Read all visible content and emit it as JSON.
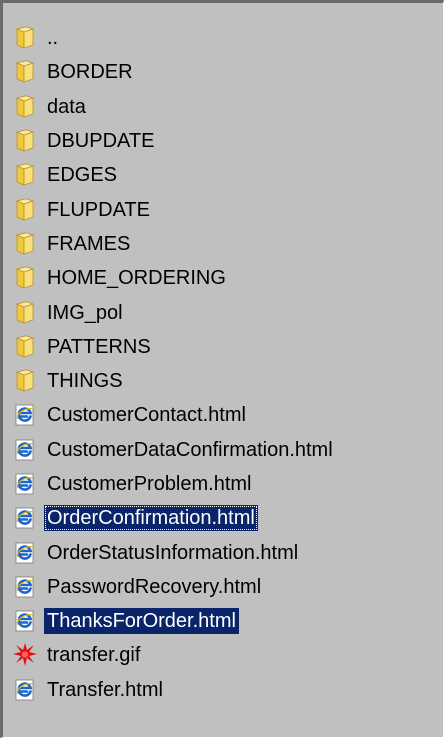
{
  "file_list": {
    "items": [
      {
        "name": "..",
        "type": "folder",
        "icon": "folder-icon",
        "selected": false
      },
      {
        "name": "BORDER",
        "type": "folder",
        "icon": "folder-icon",
        "selected": false
      },
      {
        "name": "data",
        "type": "folder",
        "icon": "folder-icon",
        "selected": false
      },
      {
        "name": "DBUPDATE",
        "type": "folder",
        "icon": "folder-icon",
        "selected": false
      },
      {
        "name": "EDGES",
        "type": "folder",
        "icon": "folder-icon",
        "selected": false
      },
      {
        "name": "FLUPDATE",
        "type": "folder",
        "icon": "folder-icon",
        "selected": false
      },
      {
        "name": "FRAMES",
        "type": "folder",
        "icon": "folder-icon",
        "selected": false
      },
      {
        "name": "HOME_ORDERING",
        "type": "folder",
        "icon": "folder-icon",
        "selected": false
      },
      {
        "name": "IMG_pol",
        "type": "folder",
        "icon": "folder-icon",
        "selected": false
      },
      {
        "name": "PATTERNS",
        "type": "folder",
        "icon": "folder-icon",
        "selected": false
      },
      {
        "name": "THINGS",
        "type": "folder",
        "icon": "folder-icon",
        "selected": false
      },
      {
        "name": "CustomerContact.html",
        "type": "html",
        "icon": "ie-html-file-icon",
        "selected": false
      },
      {
        "name": "CustomerDataConfirmation.html",
        "type": "html",
        "icon": "ie-html-file-icon",
        "selected": false
      },
      {
        "name": "CustomerProblem.html",
        "type": "html",
        "icon": "ie-html-file-icon",
        "selected": false
      },
      {
        "name": "OrderConfirmation.html",
        "type": "html",
        "icon": "ie-html-file-icon",
        "selected": true,
        "focused": true
      },
      {
        "name": "OrderStatusInformation.html",
        "type": "html",
        "icon": "ie-html-file-icon",
        "selected": false
      },
      {
        "name": "PasswordRecovery.html",
        "type": "html",
        "icon": "ie-html-file-icon",
        "selected": false
      },
      {
        "name": "ThanksForOrder.html",
        "type": "html",
        "icon": "ie-html-file-icon",
        "selected": true
      },
      {
        "name": "transfer.gif",
        "type": "gif",
        "icon": "gif-image-icon",
        "selected": false
      },
      {
        "name": "Transfer.html",
        "type": "html",
        "icon": "ie-html-file-icon",
        "selected": false
      }
    ]
  },
  "colors": {
    "panel_background": "#c0c0c0",
    "selection_background": "#0a246a",
    "selection_text": "#ffffff",
    "folder_yellow": "#f5d451"
  }
}
